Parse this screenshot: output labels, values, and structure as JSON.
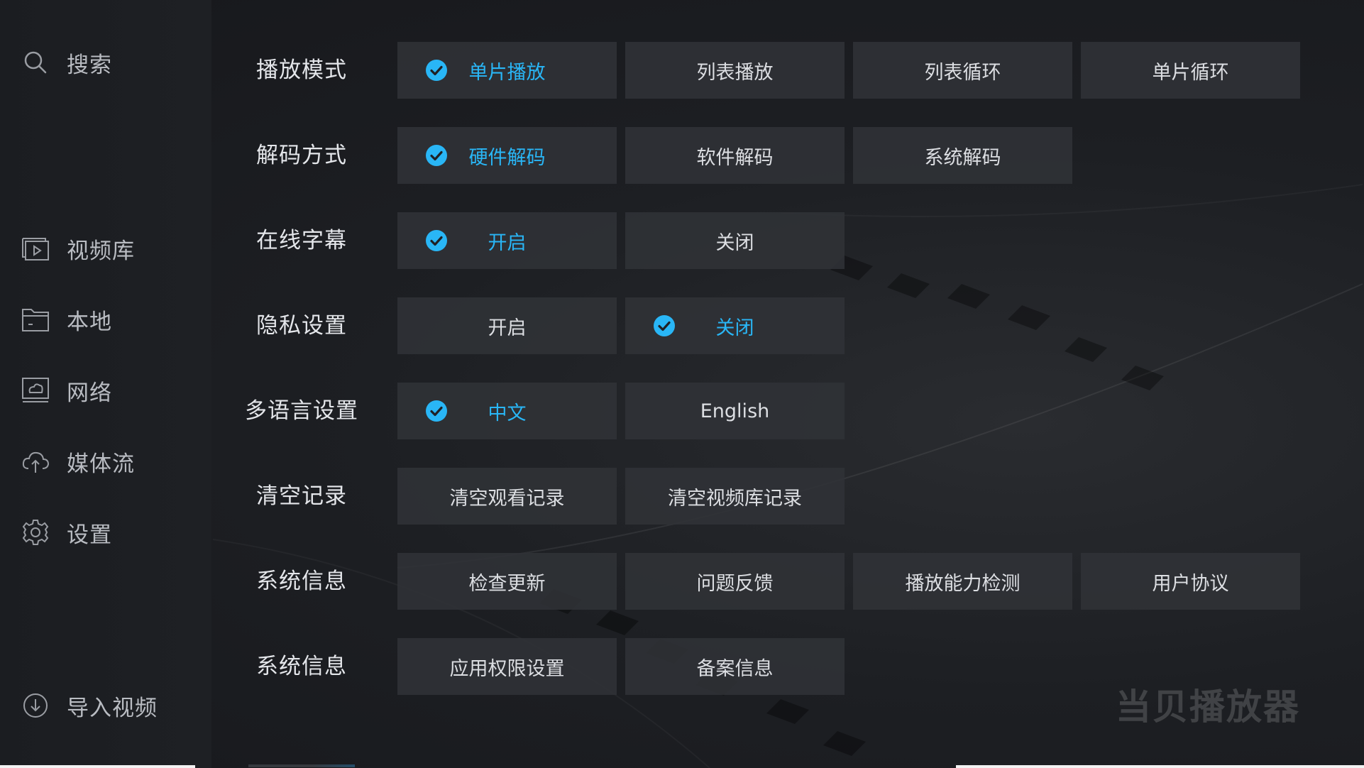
{
  "colors": {
    "accent": "#29b6f6",
    "option_bg": "#303237",
    "text": "#dcdee2",
    "sidebar_text": "#b9bcc2"
  },
  "sidebar": {
    "items": [
      {
        "label": "搜索",
        "icon": "search-icon"
      },
      {
        "label": "视频库",
        "icon": "video-library-icon"
      },
      {
        "label": "本地",
        "icon": "folder-icon"
      },
      {
        "label": "网络",
        "icon": "network-icon"
      },
      {
        "label": "媒体流",
        "icon": "cloud-icon"
      },
      {
        "label": "设置",
        "icon": "gear-icon"
      },
      {
        "label": "导入视频",
        "icon": "import-icon"
      }
    ]
  },
  "settings": {
    "rows": [
      {
        "title": "播放模式",
        "options": [
          {
            "label": "单片播放",
            "selected": true
          },
          {
            "label": "列表播放",
            "selected": false
          },
          {
            "label": "列表循环",
            "selected": false
          },
          {
            "label": "单片循环",
            "selected": false
          }
        ]
      },
      {
        "title": "解码方式",
        "options": [
          {
            "label": "硬件解码",
            "selected": true
          },
          {
            "label": "软件解码",
            "selected": false
          },
          {
            "label": "系统解码",
            "selected": false
          }
        ]
      },
      {
        "title": "在线字幕",
        "options": [
          {
            "label": "开启",
            "selected": true
          },
          {
            "label": "关闭",
            "selected": false
          }
        ]
      },
      {
        "title": "隐私设置",
        "options": [
          {
            "label": "开启",
            "selected": false
          },
          {
            "label": "关闭",
            "selected": true
          }
        ]
      },
      {
        "title": "多语言设置",
        "options": [
          {
            "label": "中文",
            "selected": true
          },
          {
            "label": "English",
            "selected": false
          }
        ]
      },
      {
        "title": "清空记录",
        "options": [
          {
            "label": "清空观看记录",
            "selected": false
          },
          {
            "label": "清空视频库记录",
            "selected": false
          }
        ]
      },
      {
        "title": "系统信息",
        "options": [
          {
            "label": "检查更新",
            "selected": false
          },
          {
            "label": "问题反馈",
            "selected": false
          },
          {
            "label": "播放能力检测",
            "selected": false
          },
          {
            "label": "用户协议",
            "selected": false
          }
        ]
      },
      {
        "title": "系统信息",
        "options": [
          {
            "label": "应用权限设置",
            "selected": false
          },
          {
            "label": "备案信息",
            "selected": false
          }
        ]
      }
    ]
  },
  "brand": {
    "logo_text": "当贝播放器"
  }
}
